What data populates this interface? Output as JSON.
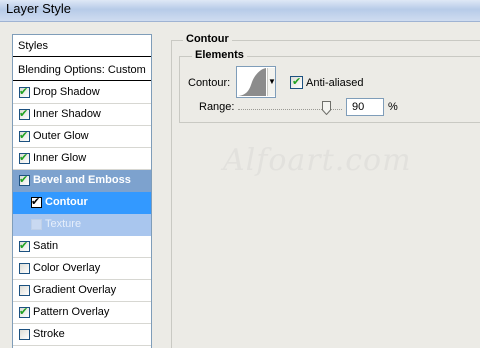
{
  "window": {
    "title": "Layer Style"
  },
  "styles_panel": {
    "header": "Styles",
    "blending_options": "Blending Options: Custom",
    "items": [
      {
        "label": "Drop Shadow",
        "checked": true
      },
      {
        "label": "Inner Shadow",
        "checked": true
      },
      {
        "label": "Outer Glow",
        "checked": true
      },
      {
        "label": "Inner Glow",
        "checked": true
      },
      {
        "label": "Bevel and Emboss",
        "checked": true
      },
      {
        "label": "Contour",
        "checked": true
      },
      {
        "label": "Texture",
        "checked": false
      },
      {
        "label": "Satin",
        "checked": true
      },
      {
        "label": "Color Overlay",
        "checked": false
      },
      {
        "label": "Gradient Overlay",
        "checked": false
      },
      {
        "label": "Pattern Overlay",
        "checked": true
      },
      {
        "label": "Stroke",
        "checked": false
      }
    ],
    "selected": "Contour"
  },
  "contour": {
    "group_title": "Contour",
    "elements_title": "Elements",
    "contour_label": "Contour:",
    "anti_aliased_label": "Anti-aliased",
    "anti_aliased": true,
    "range_label": "Range:",
    "range_value": "90",
    "range_unit": "%"
  },
  "watermark": "Alfoart.com",
  "colors": {
    "selected_row": "#3399ff",
    "parent_row": "#7da2ce",
    "child_row": "#a9c6ee",
    "check_green": "#21a121"
  }
}
